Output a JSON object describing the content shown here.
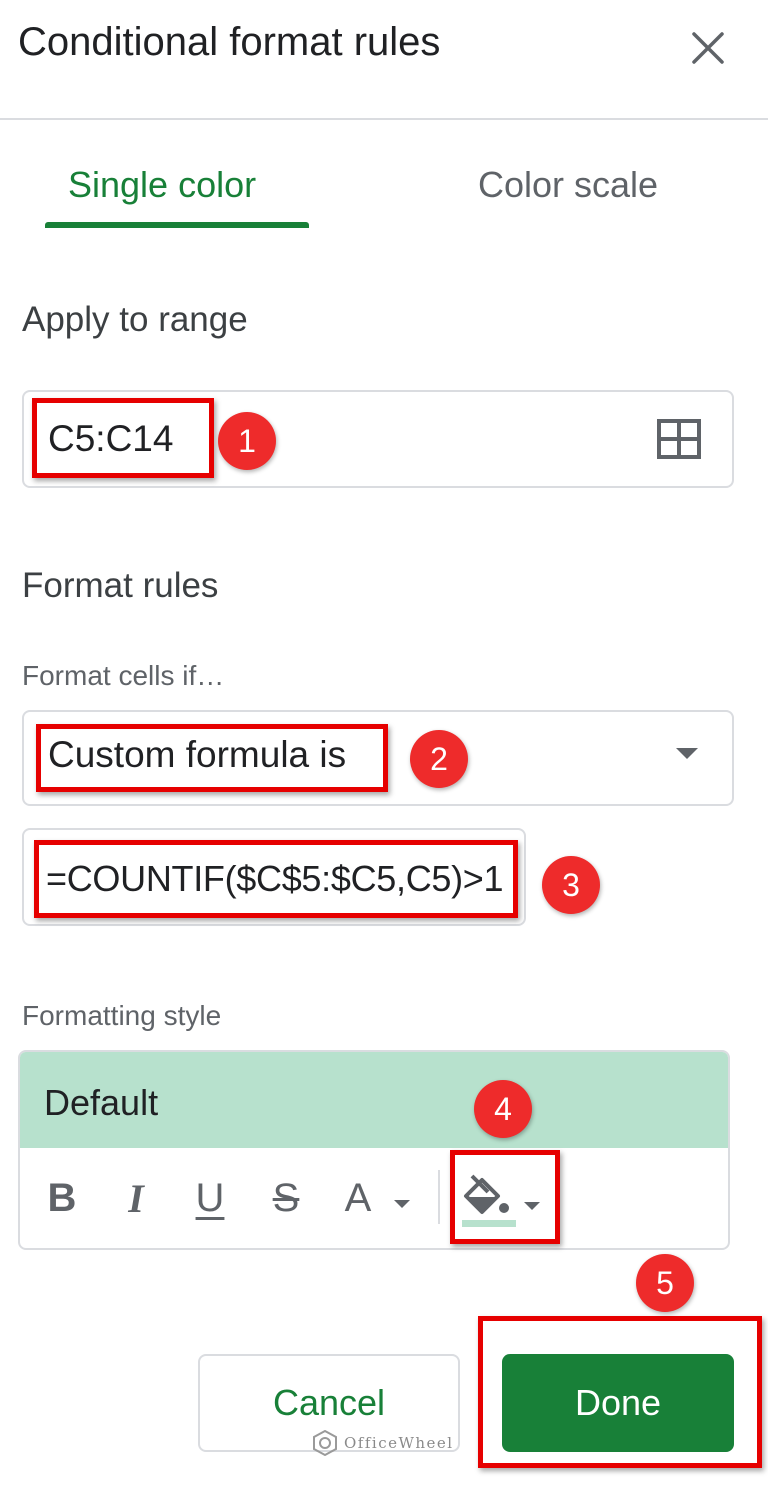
{
  "header": {
    "title": "Conditional format rules"
  },
  "tabs": [
    {
      "label": "Single color",
      "active": true
    },
    {
      "label": "Color scale",
      "active": false
    }
  ],
  "range": {
    "section_title": "Apply to range",
    "value": "C5:C14",
    "icon": "grid-icon"
  },
  "rules": {
    "section_title": "Format rules",
    "condition_label": "Format cells if…",
    "condition_value": "Custom formula is",
    "formula_value": "=COUNTIF($C$5:$C5,C5)>1"
  },
  "style": {
    "label": "Formatting style",
    "preview_text": "Default",
    "preview_color": "#b7e1cd",
    "toolbar": {
      "bold": "B",
      "italic": "I",
      "underline": "U",
      "strikethrough": "S",
      "text_color": "A"
    }
  },
  "buttons": {
    "cancel": "Cancel",
    "done": "Done"
  },
  "annotations": [
    "1",
    "2",
    "3",
    "4",
    "5"
  ],
  "watermark": "OfficeWheel",
  "colors": {
    "accent": "#188038",
    "annotation": "#e60000"
  }
}
